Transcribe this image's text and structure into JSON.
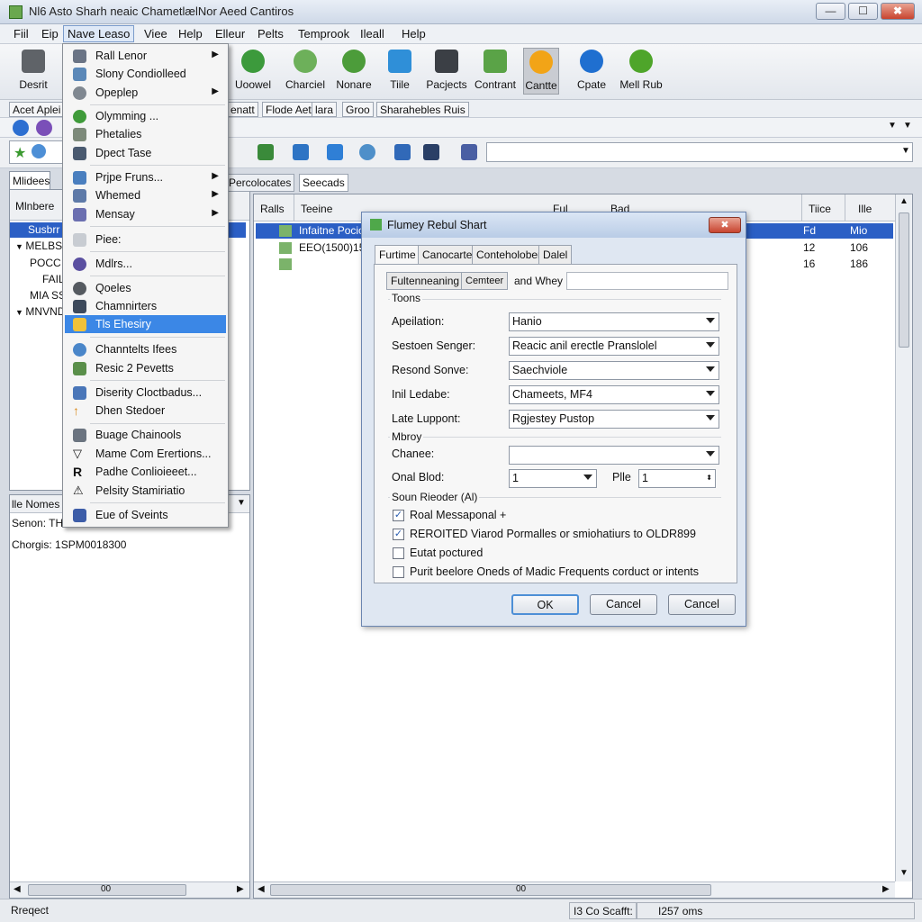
{
  "window": {
    "title": "Nl6 Asto Sharh neaic ChametlælNor Aeed Cantiros",
    "min": "—",
    "max": "☐",
    "close": "✖"
  },
  "menubar": [
    "Fiil",
    "Eip",
    "Nave Leaso",
    "Viee",
    "Help",
    "Elleur",
    "Pelts",
    "Temprook",
    "Ileall",
    "Help"
  ],
  "toolbar": [
    "Desrit",
    "Uoowel",
    "Charciel",
    "Nonare",
    "Tiile",
    "Pacjects",
    "Contrant",
    "Cantte",
    "Cpate",
    "Mell Rub"
  ],
  "tabstrip2": {
    "left": "Acet Aplei",
    "tabs": [
      "Flode Aet",
      "lara",
      "Groo",
      "Sharahebles Ruis"
    ],
    "partial": "enatt"
  },
  "menu": {
    "items": [
      "Rall Lenor",
      "Slony Condiolleed",
      "Opeplep",
      "Olymming ...",
      "Phetalies",
      "Dpect Tase",
      "Prjpe Fruns...",
      "Whemed",
      "Mensay",
      "Piee:",
      "Mdlrs...",
      "Qoeles",
      "Chamnirters",
      "Tls Ehesiry",
      "Channtelts Ifees",
      "Resic 2 Pevetts",
      "Diserity Cloctbadus...",
      "Dhen Stedoer",
      "Buage Chainools",
      "Mame Com Erertions...",
      "Padhe Conlioieeet...",
      "Pelsity Stamiriatio",
      "Eue of Sveints"
    ]
  },
  "leftpanel": {
    "tab": "Mlidees",
    "header": "Mlnbere",
    "rows": [
      "Susbrr",
      "MELBS",
      "POCC",
      "FAIL",
      "MIA SS",
      "MNVNDC"
    ],
    "bottom_tab": "lle Nomes",
    "bottom_rows": [
      "Senon: THS",
      "Chorgis: 1SPM0018300"
    ],
    "scroll_label": "00"
  },
  "rightpanel": {
    "tabs": [
      "Percolocates",
      "Seecads"
    ],
    "headers": [
      "Ralls",
      "Teeine",
      "Ful",
      "Bad",
      "Tiice",
      "Ille"
    ],
    "rows": [
      {
        "name": "Infaitne Pocio",
        "tice": "Fd",
        "ille": "Mio"
      },
      {
        "name": "EEO(1500)15",
        "tice": "12",
        "ille": "106"
      },
      {
        "name": "",
        "tice": "16",
        "ille": "186"
      }
    ],
    "scroll_label": "00"
  },
  "dialog": {
    "title": "Flumey Rebul Shart",
    "close": "✖",
    "tabs": [
      "Furtime",
      "Canocarte",
      "Conteholoben",
      "Dalel"
    ],
    "subtabs": [
      "Fultenneaning",
      "Cemteer"
    ],
    "subtab_label": "and Whey",
    "section1": "Toons",
    "fields": [
      {
        "label": "Apeilation:",
        "value": "Hanio"
      },
      {
        "label": "Sestoen Senger:",
        "value": "Reacic anil erectle Pranslolel"
      },
      {
        "label": "Resond Sonve:",
        "value": "Saechviole"
      },
      {
        "label": "Inil Ledabe:",
        "value": "Chameets, MF4"
      },
      {
        "label": "Late Luppont:",
        "value": "Rgjestey Pustop"
      }
    ],
    "section2": "Mbroy",
    "channel_label": "Chanee:",
    "channel_value": "",
    "onal_label": "Onal Blod:",
    "onal_value": "1",
    "pile_label": "Plle",
    "pile_value": "1",
    "section3": "Soun Rieoder (Al)",
    "checks": [
      {
        "label": "Roal Messaponal +",
        "checked": true
      },
      {
        "label": "REROITED Viarod Pormalles or smiohatiurs to OLDR899",
        "checked": true
      },
      {
        "label": "Eutat poctured",
        "checked": false
      },
      {
        "label": "Purit beelore Oneds of Madic Frequents corduct or intents",
        "checked": false
      }
    ],
    "ok": "OK",
    "cancel1": "Cancel",
    "cancel2": "Cancel"
  },
  "statusbar": {
    "left": "Rreqect",
    "mid": "I3 Co Scafft:",
    "right": "I257 oms"
  }
}
